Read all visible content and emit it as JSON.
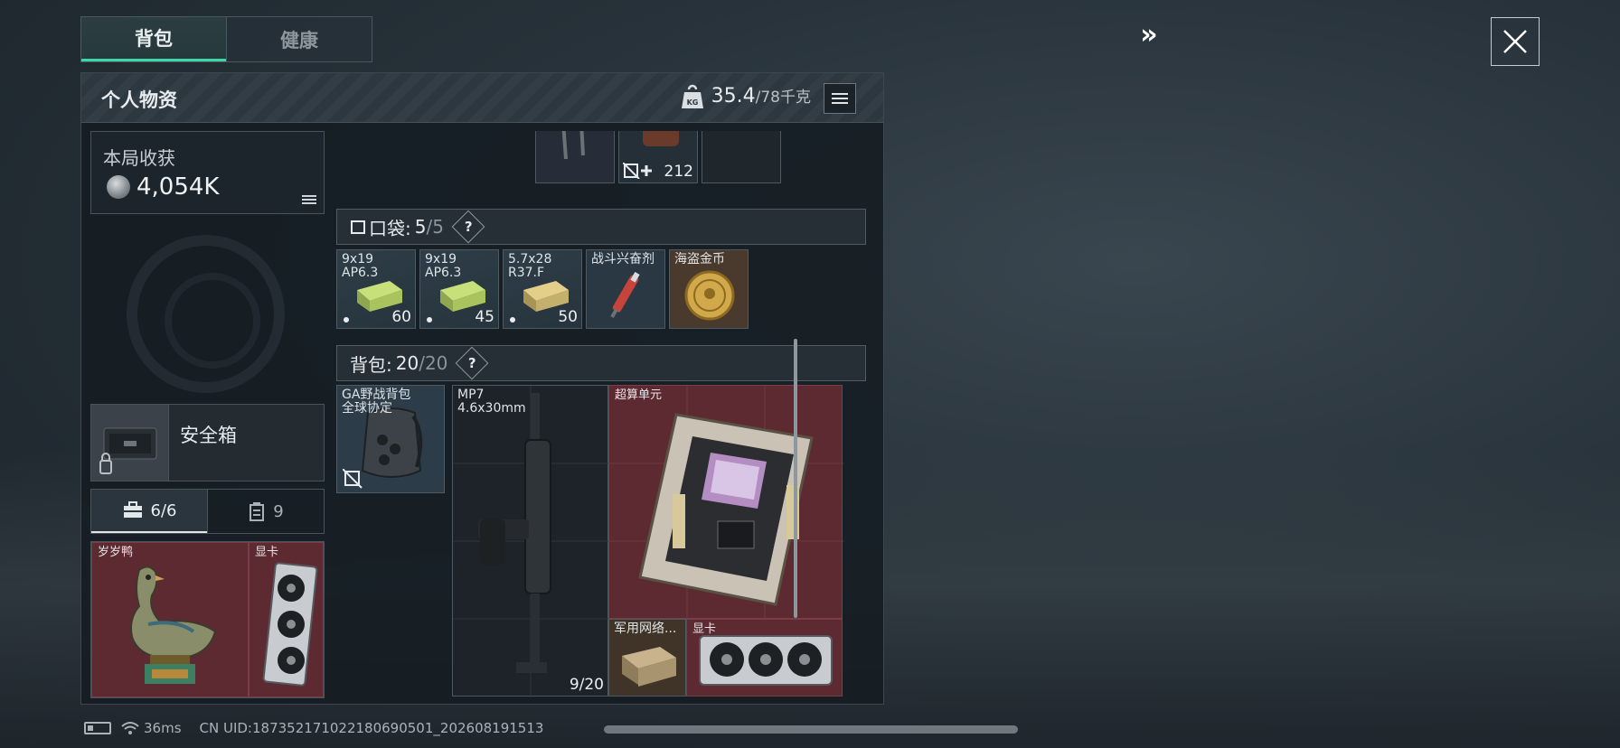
{
  "tabs": {
    "backpack": "背包",
    "health": "健康"
  },
  "panel": {
    "title": "个人物资",
    "weight_current": "35.4",
    "weight_max": "/78千克",
    "weight_icon": "kg-weight-icon"
  },
  "harvest": {
    "label": "本局收获",
    "value": "4,054K"
  },
  "safebox": {
    "label": "安全箱"
  },
  "pouch_tabs": {
    "case_count": "6/6",
    "slot_count": "9"
  },
  "pouch_items": [
    {
      "label": "岁岁鸭"
    },
    {
      "label": "显卡"
    }
  ],
  "top_row": {
    "medkit_qty": "212"
  },
  "pockets": {
    "label": "口袋:",
    "count": "5",
    "max": "/5",
    "help": "?",
    "items": [
      {
        "line1": "9x19",
        "line2": "AP6.3",
        "qty": "60"
      },
      {
        "line1": "9x19",
        "line2": "AP6.3",
        "qty": "45"
      },
      {
        "line1": "5.7x28",
        "line2": "R37.F",
        "qty": "50"
      },
      {
        "line1": "战斗兴奋剂",
        "line2": "",
        "qty": ""
      },
      {
        "line1": "海盗金币",
        "line2": "",
        "qty": ""
      }
    ]
  },
  "backpack": {
    "label": "背包:",
    "count": "20",
    "max": "/20",
    "help": "?",
    "items": {
      "bag": {
        "line1": "GA野战背包",
        "line2": "全球协定"
      },
      "gun": {
        "line1": "MP7",
        "line2": "4.6x30mm",
        "ammo": "9/20"
      },
      "supercomputer": {
        "label": "超算单元"
      },
      "network": {
        "label": "军用网络..."
      },
      "gpu": {
        "label": "显卡"
      }
    }
  },
  "status": {
    "ping": "36ms",
    "uid": "CN UID:18735217102218069050​1_202608191513"
  }
}
